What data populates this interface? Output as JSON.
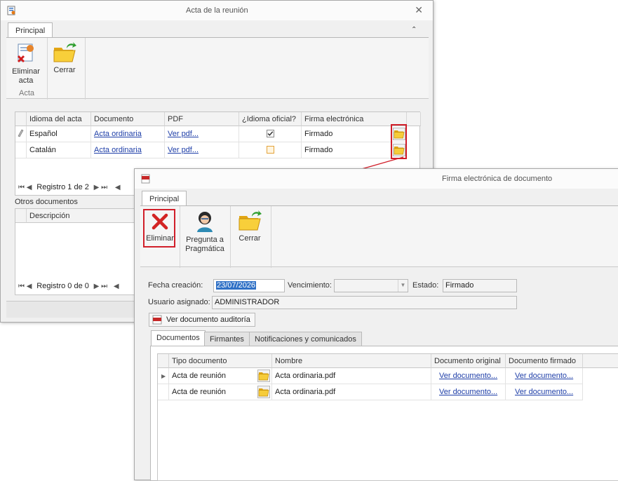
{
  "acta_window": {
    "title": "Acta de la reunión",
    "tab": "Principal",
    "ribbon": {
      "eliminar_line1": "Eliminar",
      "eliminar_line2": "acta",
      "cerrar": "Cerrar",
      "group": "Acta"
    },
    "grid": {
      "headers": [
        "Idioma del acta",
        "Documento",
        "PDF",
        "¿Idioma oficial?",
        "Firma electrónica"
      ],
      "rows": [
        {
          "idioma": "Español",
          "documento": "Acta ordinaria",
          "pdf": "Ver pdf...",
          "oficial": true,
          "firma": "Firmado"
        },
        {
          "idioma": "Catalán",
          "documento": "Acta ordinaria",
          "pdf": "Ver pdf...",
          "oficial": false,
          "firma": "Firmado"
        }
      ],
      "nav": "Registro 1 de 2"
    },
    "otros": {
      "label": "Otros documentos",
      "header": "Descripción",
      "nav": "Registro 0 de 0"
    }
  },
  "firma_window": {
    "title": "Firma electrónica de documento",
    "tab": "Principal",
    "ribbon": {
      "eliminar": "Eliminar",
      "pregunta_line1": "Pregunta a",
      "pregunta_line2": "Pragmática",
      "cerrar": "Cerrar"
    },
    "form": {
      "fecha_label": "Fecha creación:",
      "fecha_value": "23/07/2026",
      "vencimiento_label": "Vencimiento:",
      "vencimiento_value": "",
      "estado_label": "Estado:",
      "estado_value": "Firmado",
      "usuario_label": "Usuario asignado:",
      "usuario_value": "ADMINISTRADOR",
      "auditoria_button": "Ver documento auditoría"
    },
    "tabs": [
      "Documentos",
      "Firmantes",
      "Notificaciones y comunicados"
    ],
    "grid": {
      "headers": [
        "Tipo documento",
        "Nombre",
        "Documento original",
        "Documento firmado"
      ],
      "rows": [
        {
          "tipo": "Acta de reunión",
          "nombre": "Acta ordinaria.pdf",
          "original": "Ver documento...",
          "firmado": "Ver documento..."
        },
        {
          "tipo": "Acta de reunión",
          "nombre": "Acta ordinaria.pdf",
          "original": "Ver documento...",
          "firmado": "Ver documento..."
        }
      ]
    }
  },
  "colors": {
    "highlight_red": "#d11f2a",
    "link_blue": "#1f3fa8",
    "selection_blue": "#3071c6"
  }
}
